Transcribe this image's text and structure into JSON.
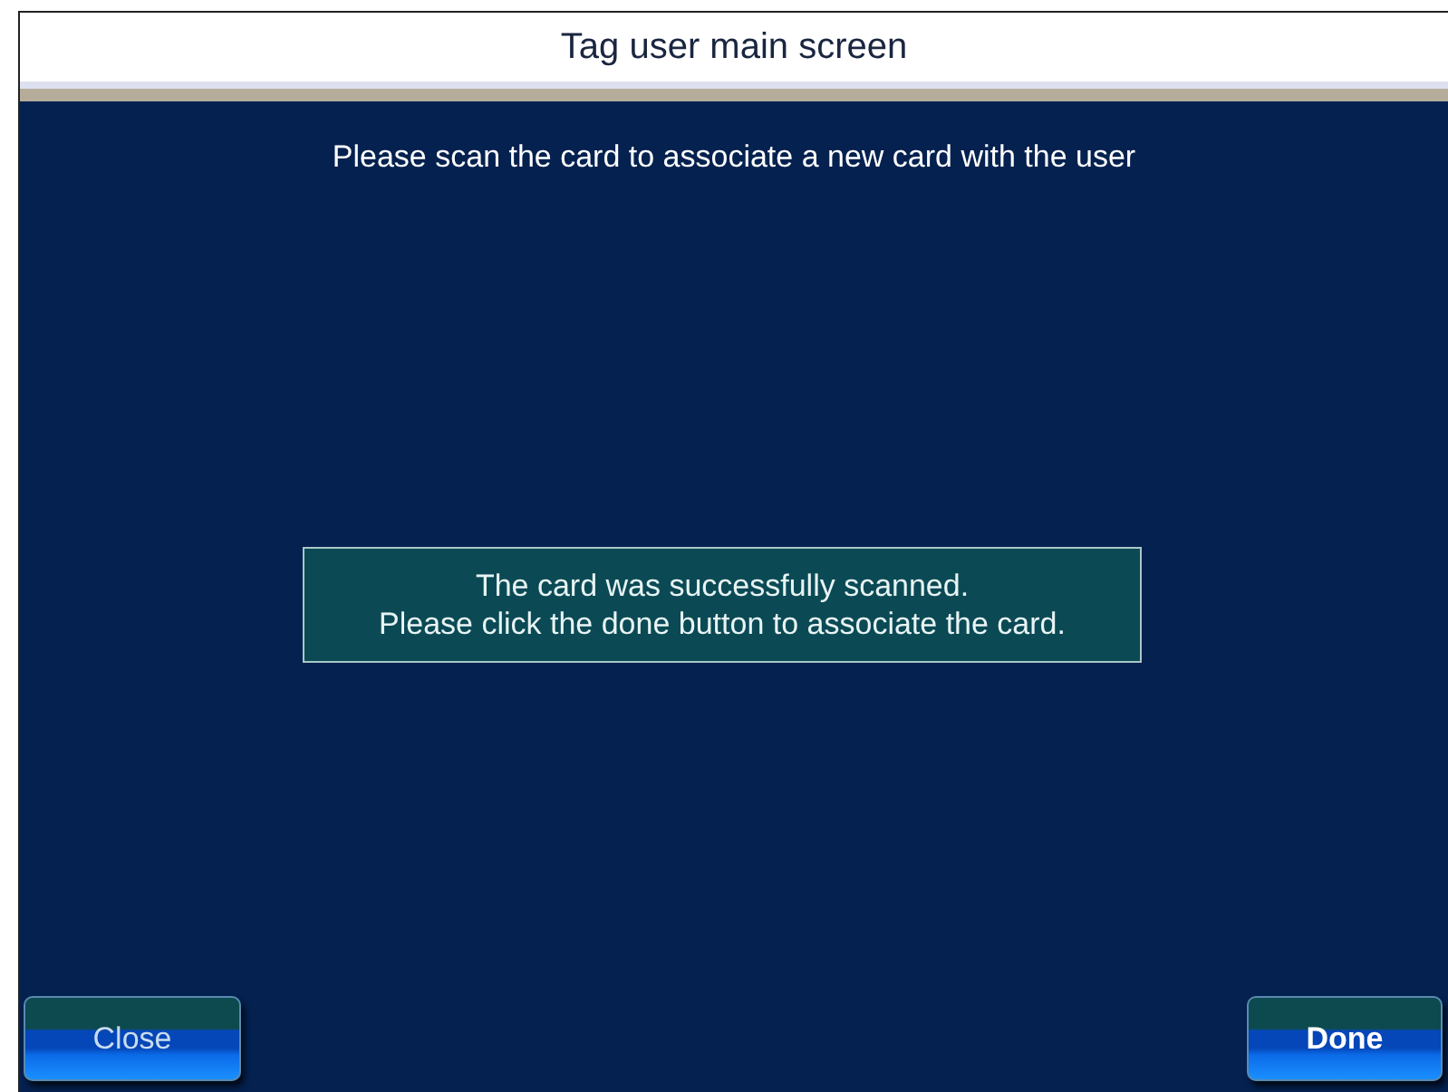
{
  "window": {
    "title": "Tag user main screen"
  },
  "instruction": "Please scan the card to associate a new card with the user",
  "message": {
    "lines": [
      "The card was successfully scanned.",
      "Please click the done button to associate the card."
    ]
  },
  "buttons": [
    {
      "label": "Close",
      "kind": "secondary"
    },
    {
      "label": "Done",
      "kind": "primary"
    }
  ]
}
